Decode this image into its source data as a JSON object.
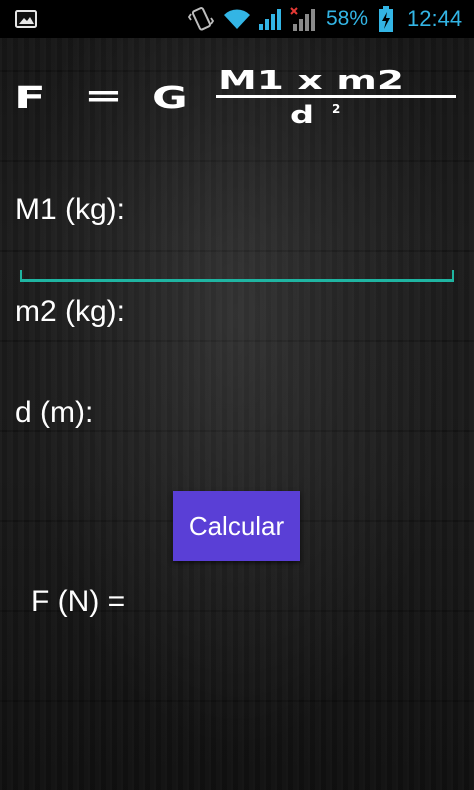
{
  "status_bar": {
    "battery_percent": "58%",
    "time": "12:44",
    "accent_color": "#33b5e5",
    "icons": [
      "gallery-icon",
      "vibrate-icon",
      "wifi-icon",
      "signal-icon",
      "signal-no-data-icon",
      "battery-charging-icon"
    ]
  },
  "formula": {
    "f": "F",
    "equals": "=",
    "g": "G",
    "numerator": "M1 x m2",
    "denominator": "d",
    "exponent": "2"
  },
  "fields": {
    "m1_label": "M1 (kg):",
    "m1_value": "",
    "m2_label": "m2 (kg):",
    "m2_value": "",
    "d_label": "d (m):",
    "d_value": "",
    "focus_color": "#1fb5a2"
  },
  "button": {
    "calculate_label": "Calcular",
    "color": "#5a3fd6"
  },
  "result": {
    "label": "F (N) =",
    "value": ""
  }
}
